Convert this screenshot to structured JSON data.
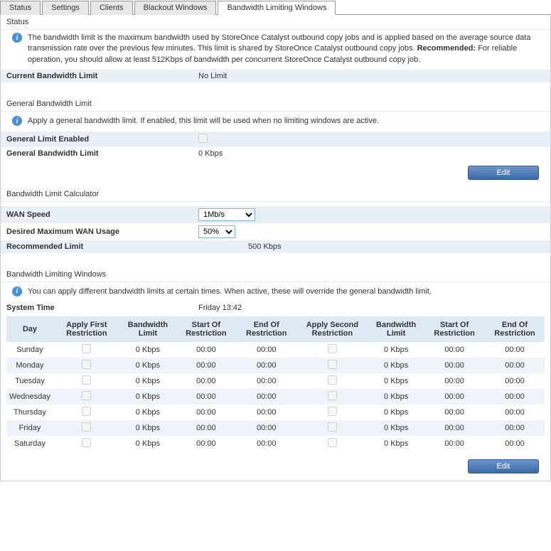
{
  "tabs": [
    "Status",
    "Settings",
    "Clients",
    "Blackout Windows",
    "Bandwidth Limiting Windows"
  ],
  "active_tab": 4,
  "status": {
    "title": "Status",
    "info_pre": "The bandwidth limit is the maximum bandwidth used by StoreOnce Catalyst outbound copy jobs and is applied based on the average source data transmission rate over the previous few minutes. This limit is shared by StoreOnce Catalyst outbound copy jobs. ",
    "info_rec_label": "Recommended:",
    "info_rec_text": " For reliable operation, you should allow at least 512Kbps of bandwidth per concurrent StoreOnce Catalyst outbound copy job.",
    "current_label": "Current Bandwidth Limit",
    "current_value": "No Limit"
  },
  "general": {
    "title": "General Bandwidth Limit",
    "info": "Apply a general bandwidth limit. If enabled, this limit will be used when no limiting windows are active.",
    "enabled_label": "General Limit Enabled",
    "limit_label": "General Bandwidth Limit",
    "limit_value": "0 Kbps",
    "edit": "Edit"
  },
  "calc": {
    "title": "Bandwidth Limit Calculator",
    "wan_label": "WAN Speed",
    "wan_value": "1Mb/s",
    "usage_label": "Desired Maximum WAN Usage",
    "usage_value": "50%",
    "rec_label": "Recommended Limit",
    "rec_value": "500",
    "rec_unit": " Kbps"
  },
  "windows": {
    "title": "Bandwidth Limiting Windows",
    "info": "You can apply different bandwidth limits at certain times. When active, these will override the general bandwidth limit.",
    "systime_label": "System Time",
    "systime_value": "Friday 13:42",
    "headers": [
      "Day",
      "Apply First Restriction",
      "Bandwidth Limit",
      "Start Of Restriction",
      "End Of Restriction",
      "Apply Second Restriction",
      "Bandwidth Limit",
      "Start Of Restriction",
      "End Of Restriction"
    ],
    "rows": [
      {
        "day": "Sunday",
        "bw1": "0 Kbps",
        "s1": "00:00",
        "e1": "00:00",
        "bw2": "0 Kbps",
        "s2": "00:00",
        "e2": "00:00"
      },
      {
        "day": "Monday",
        "bw1": "0 Kbps",
        "s1": "00:00",
        "e1": "00:00",
        "bw2": "0 Kbps",
        "s2": "00:00",
        "e2": "00:00"
      },
      {
        "day": "Tuesday",
        "bw1": "0 Kbps",
        "s1": "00:00",
        "e1": "00:00",
        "bw2": "0 Kbps",
        "s2": "00:00",
        "e2": "00:00"
      },
      {
        "day": "Wednesday",
        "bw1": "0 Kbps",
        "s1": "00:00",
        "e1": "00:00",
        "bw2": "0 Kbps",
        "s2": "00:00",
        "e2": "00:00"
      },
      {
        "day": "Thursday",
        "bw1": "0 Kbps",
        "s1": "00:00",
        "e1": "00:00",
        "bw2": "0 Kbps",
        "s2": "00:00",
        "e2": "00:00"
      },
      {
        "day": "Friday",
        "bw1": "0 Kbps",
        "s1": "00:00",
        "e1": "00:00",
        "bw2": "0 Kbps",
        "s2": "00:00",
        "e2": "00:00"
      },
      {
        "day": "Saturday",
        "bw1": "0 Kbps",
        "s1": "00:00",
        "e1": "00:00",
        "bw2": "0 Kbps",
        "s2": "00:00",
        "e2": "00:00"
      }
    ],
    "edit": "Edit"
  }
}
